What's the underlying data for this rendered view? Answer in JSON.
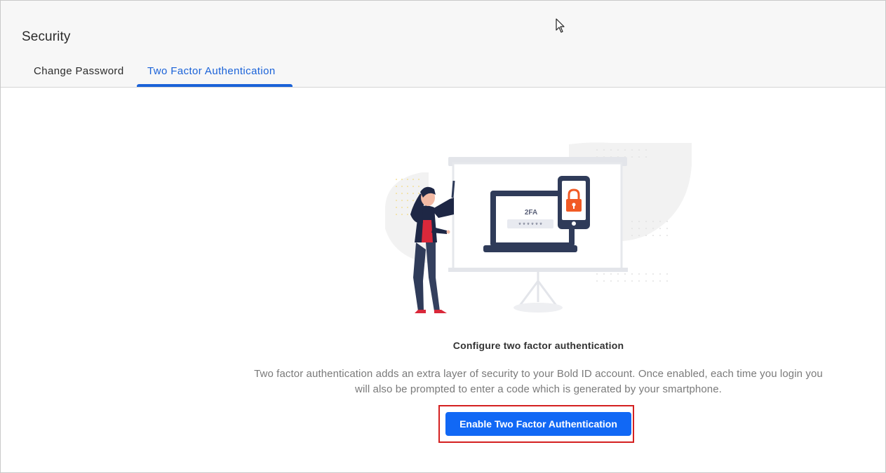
{
  "header": {
    "title": "Security",
    "tabs": [
      {
        "label": "Change Password",
        "active": false
      },
      {
        "label": "Two Factor Authentication",
        "active": true
      }
    ]
  },
  "illustration": {
    "screen_label": "2FA",
    "code_mask": "* * * * * *",
    "icons": [
      "presenter-figure",
      "laptop-icon",
      "smartphone-icon",
      "padlock-icon",
      "projector-screen"
    ]
  },
  "main": {
    "heading": "Configure two factor authentication",
    "description_line1": "Two factor authentication adds an extra layer of security to your Bold ID account. Once enabled, each time you login you",
    "description_line2": "will also be prompted to enter a code which is generated by your smartphone.",
    "enable_button_label": "Enable Two Factor Authentication"
  },
  "colors": {
    "accent": "#1a62d8",
    "button": "#1168f5",
    "highlight": "#d42020",
    "lock": "#f15a24",
    "navy": "#2f3b59"
  }
}
